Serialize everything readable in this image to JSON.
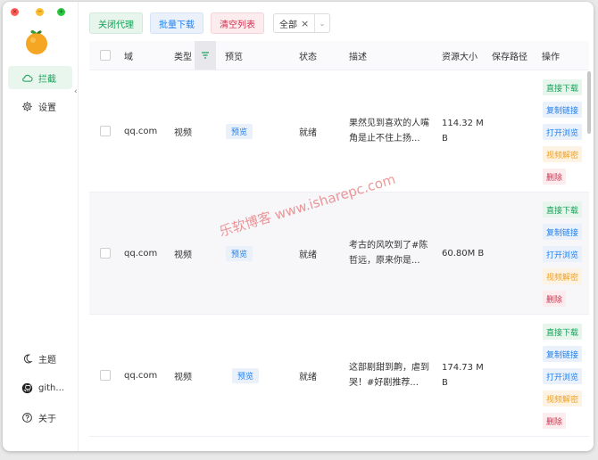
{
  "window_controls": {
    "close": "×",
    "minimize": "−",
    "maximize": "+"
  },
  "sidebar": {
    "nav": [
      {
        "label": "拦截",
        "icon": "cloud-icon",
        "active": true
      },
      {
        "label": "设置",
        "icon": "gear-icon",
        "active": false
      }
    ],
    "bottom": [
      {
        "label": "主题",
        "icon": "moon-icon"
      },
      {
        "label": "gith...",
        "icon": "github-icon"
      },
      {
        "label": "关于",
        "icon": "help-circle-icon"
      }
    ],
    "collapse_glyph": "‹"
  },
  "toolbar": {
    "close_proxy": "关闭代理",
    "batch_download": "批量下载",
    "clear_list": "清空列表",
    "filter_tag": "全部",
    "filter_tag_close": "×",
    "filter_arrow": "⌄"
  },
  "table": {
    "headers": {
      "domain": "域",
      "type": "类型",
      "preview": "预览",
      "status": "状态",
      "description": "描述",
      "size": "资源大小",
      "save_path": "保存路径",
      "actions": "操作"
    },
    "rows": [
      {
        "domain": "qq.com",
        "type": "视频",
        "preview": "预览",
        "status": "就绪",
        "description": "果然见到喜欢的人嘴角是止不住上扬...",
        "size": "114.32 MB"
      },
      {
        "domain": "qq.com",
        "type": "视频",
        "preview": "预览",
        "status": "就绪",
        "description": "考古的风吹到了#陈哲远，原来你是...",
        "size": "60.80M B"
      },
      {
        "domain": "qq.com",
        "type": "视频",
        "preview": "预览",
        "status": "就绪",
        "description": "这部剧甜到齁，虐到哭！#好剧推荐...",
        "size": "174.73 MB"
      }
    ],
    "row_actions": [
      "直接下载",
      "复制链接",
      "打开浏览",
      "视频解密",
      "删除"
    ]
  },
  "watermark": "乐软博客 www.isharepc.com",
  "colors": {
    "accent_green": "#18a058",
    "accent_blue": "#2080f0",
    "accent_red": "#d03050",
    "accent_orange": "#f0a020"
  }
}
